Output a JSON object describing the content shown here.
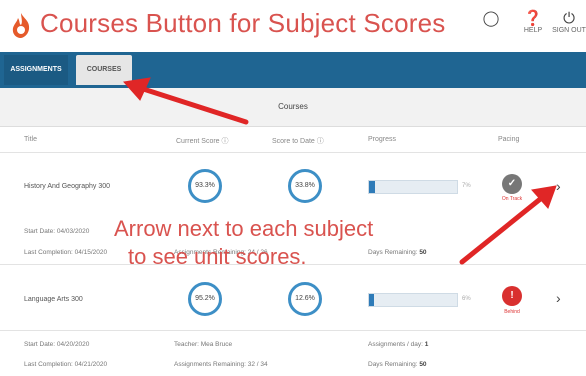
{
  "header": {
    "title": "Courses Button for Subject Scores",
    "icons": [
      {
        "name": "lightbulb-icon",
        "label": ""
      },
      {
        "name": "help-icon",
        "label": "HELP"
      },
      {
        "name": "power-icon",
        "label": "SIGN OUT"
      }
    ]
  },
  "nav": {
    "tabs": [
      {
        "label": "Assignments",
        "active": false
      },
      {
        "label": "Courses",
        "active": true
      }
    ]
  },
  "page": {
    "title": "Courses"
  },
  "table": {
    "columns": [
      "Title",
      "Current Score",
      "Score to Date",
      "Progress",
      "Pacing"
    ],
    "rows": [
      {
        "title": "History And Geography 300",
        "current_score": "93.3%",
        "score_to_date": "33.8%",
        "progress_pct": 7,
        "progress_label": "7%",
        "pacing": {
          "symbol": "✓",
          "label": "On Track",
          "color": "#777777"
        },
        "start_date": "Start Date: 04/03/2020",
        "last_completion": "Last Completion: 04/15/2020",
        "assignments_remaining": "Assignments Remaining: 24 / 26",
        "days_remaining_label": "Days Remaining:",
        "days_remaining": "50"
      },
      {
        "title": "Language Arts 300",
        "current_score": "95.2%",
        "score_to_date": "12.6%",
        "progress_pct": 6,
        "progress_label": "6%",
        "pacing": {
          "symbol": "!",
          "label": "Behind",
          "color": "#d9302f"
        },
        "start_date": "Start Date: 04/20/2020",
        "teacher": "Teacher: Mea Bruce",
        "last_completion": "Last Completion: 04/21/2020",
        "assignments_remaining": "Assignments Remaining: 32 / 34",
        "assignments_per_day_label": "Assignments / day:",
        "assignments_per_day": "1",
        "days_remaining_label": "Days Remaining:",
        "days_remaining": "50"
      }
    ]
  },
  "annotations": {
    "line1": "Arrow next to each subject",
    "line2": "to see unit scores.",
    "color": "#d9534f"
  },
  "colors": {
    "nav": "#1f6592",
    "accent": "#2e7bb8",
    "annotation": "#d9534f"
  }
}
